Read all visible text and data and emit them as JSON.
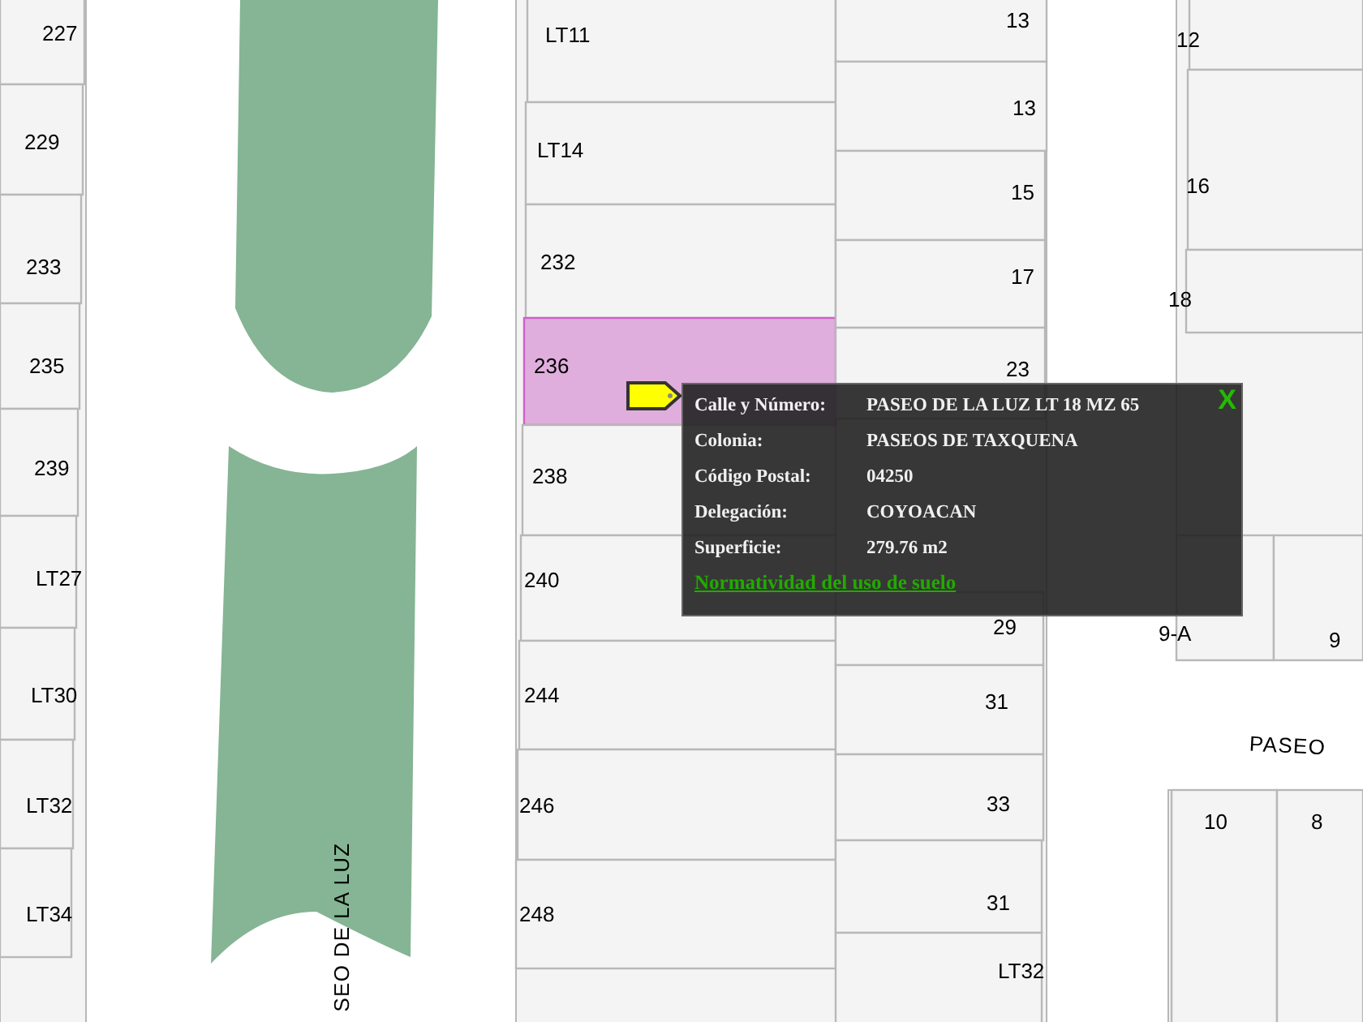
{
  "map": {
    "lots": [
      {
        "label": "227",
        "selected": false
      },
      {
        "label": "229",
        "selected": false
      },
      {
        "label": "233",
        "selected": false
      },
      {
        "label": "235",
        "selected": false
      },
      {
        "label": "239",
        "selected": false
      },
      {
        "label": "LT27",
        "selected": false
      },
      {
        "label": "LT30",
        "selected": false
      },
      {
        "label": "LT32",
        "selected": false
      },
      {
        "label": "LT34",
        "selected": false
      },
      {
        "label": "LT11",
        "selected": false
      },
      {
        "label": "LT14",
        "selected": false
      },
      {
        "label": "232",
        "selected": false
      },
      {
        "label": "236",
        "selected": true
      },
      {
        "label": "238",
        "selected": false
      },
      {
        "label": "240",
        "selected": false
      },
      {
        "label": "244",
        "selected": false
      },
      {
        "label": "246",
        "selected": false
      },
      {
        "label": "248",
        "selected": false
      },
      {
        "label": "13",
        "selected": false
      },
      {
        "label": "13",
        "selected": false
      },
      {
        "label": "15",
        "selected": false
      },
      {
        "label": "17",
        "selected": false
      },
      {
        "label": "23",
        "selected": false
      },
      {
        "label": "29",
        "selected": false
      },
      {
        "label": "31",
        "selected": false
      },
      {
        "label": "33",
        "selected": false
      },
      {
        "label": "31",
        "selected": false
      },
      {
        "label": "LT32",
        "selected": false
      },
      {
        "label": "12",
        "selected": false
      },
      {
        "label": "16",
        "selected": false
      },
      {
        "label": "18",
        "selected": false
      },
      {
        "label": "9-A",
        "selected": false
      },
      {
        "label": "9",
        "selected": false
      },
      {
        "label": "10",
        "selected": false
      },
      {
        "label": "8",
        "selected": false
      }
    ],
    "street_labels": [
      "PASEO",
      "SEO DE LA LUZ"
    ]
  },
  "popup": {
    "fields": [
      {
        "label": "Calle y Número:",
        "value": "PASEO DE LA LUZ LT 18 MZ 65"
      },
      {
        "label": "Colonia:",
        "value": "PASEOS DE TAXQUENA"
      },
      {
        "label": "Código Postal:",
        "value": "04250"
      },
      {
        "label": "Delegación:",
        "value": "COYOACAN"
      },
      {
        "label": "Superficie:",
        "value": "279.76 m2"
      }
    ],
    "link": "Normatividad del uso de suelo",
    "close": "X"
  }
}
